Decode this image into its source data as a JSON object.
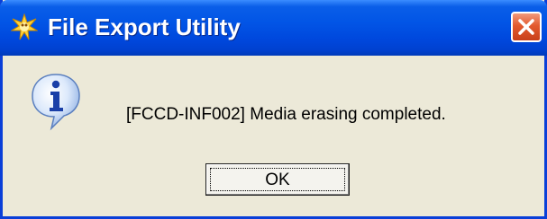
{
  "window": {
    "title": "File Export Utility",
    "app_icon": "star-burst-icon",
    "close_icon": "close-icon"
  },
  "dialog": {
    "icon": "info-icon",
    "message": "[FCCD-INF002]  Media erasing completed.",
    "ok_label": "OK"
  },
  "colors": {
    "titlebar": "#0255e6",
    "window_body": "#ece9d8",
    "close_button": "#e35a2e"
  }
}
